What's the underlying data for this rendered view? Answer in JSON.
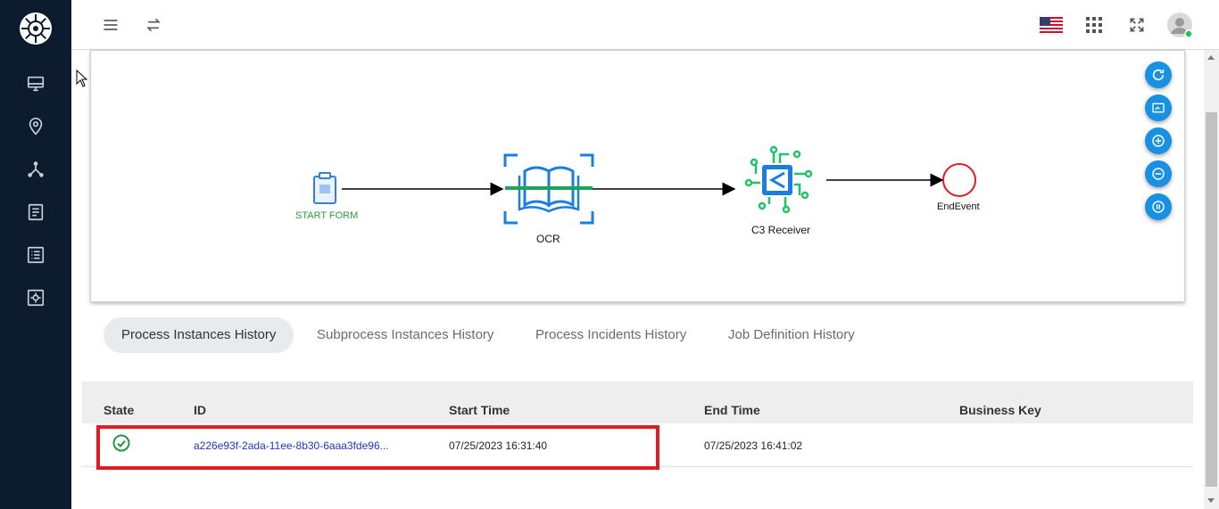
{
  "colors": {
    "sidebar_bg": "#0d1b2e",
    "accent_fab": "#1891e5",
    "success": "#1a9a3a",
    "link": "#1f35c9",
    "highlight": "#e01b24"
  },
  "sidebar": {
    "items": [
      {
        "icon": "monitor-icon"
      },
      {
        "icon": "location-pin-icon"
      },
      {
        "icon": "network-icon"
      },
      {
        "icon": "document-icon"
      },
      {
        "icon": "list-icon"
      },
      {
        "icon": "settings-box-icon"
      }
    ]
  },
  "topbar": {
    "icons": [
      "menu-icon",
      "swap-icon",
      "us-flag-icon",
      "apps-grid-icon",
      "fullscreen-icon",
      "user-avatar-icon"
    ]
  },
  "diagram": {
    "nodes": {
      "start": "START FORM",
      "ocr": "OCR",
      "receiver": "C3 Receiver",
      "end": "EndEvent"
    },
    "controls": [
      "refresh-icon",
      "fit-view-icon",
      "zoom-in-icon",
      "zoom-out-icon",
      "pause-icon"
    ]
  },
  "tabs": [
    {
      "label": "Process Instances History",
      "active": true
    },
    {
      "label": "Subprocess Instances History",
      "active": false
    },
    {
      "label": "Process Incidents History",
      "active": false
    },
    {
      "label": "Job Definition History",
      "active": false
    }
  ],
  "table": {
    "columns": [
      "State",
      "ID",
      "Start Time",
      "End Time",
      "Business Key"
    ],
    "rows": [
      {
        "state": "completed",
        "id": "a226e93f-2ada-11ee-8b30-6aaa3fde96...",
        "start_time": "07/25/2023 16:31:40",
        "end_time": "07/25/2023 16:41:02",
        "business_key": ""
      }
    ]
  }
}
